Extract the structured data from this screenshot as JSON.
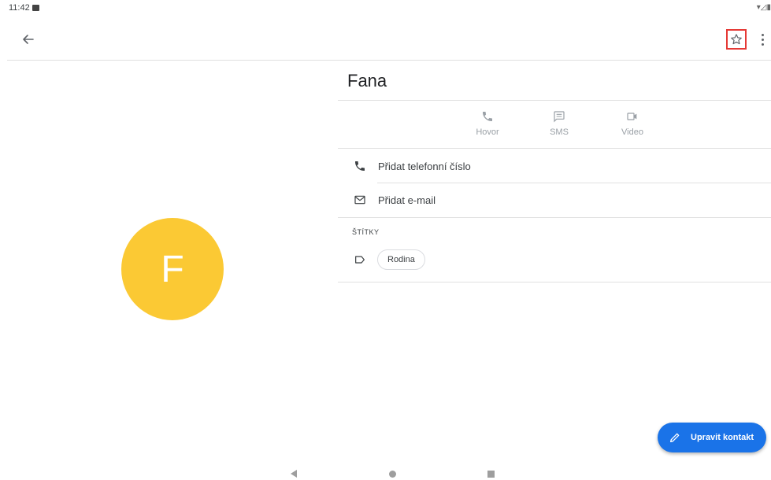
{
  "status_bar": {
    "time": "11:42",
    "right_icons": "▾◿▮"
  },
  "toolbar": {
    "back_icon": "arrow-left",
    "star_icon": "star-outline",
    "more_icon": "vertical-dots"
  },
  "contact": {
    "avatar_letter": "F",
    "avatar_color": "#fbc934",
    "name": "Fana"
  },
  "actions": [
    {
      "label": "Hovor",
      "icon": "phone"
    },
    {
      "label": "SMS",
      "icon": "message"
    },
    {
      "label": "Video",
      "icon": "videocam"
    }
  ],
  "rows": {
    "phone": "Přidat telefonní číslo",
    "email": "Přidat e-mail"
  },
  "labels": {
    "heading": "ŠTÍTKY",
    "chip": "Rodina"
  },
  "fab": {
    "label": "Upravit kontakt",
    "color": "#1a73e8"
  },
  "colors": {
    "highlight": "#e53935"
  }
}
